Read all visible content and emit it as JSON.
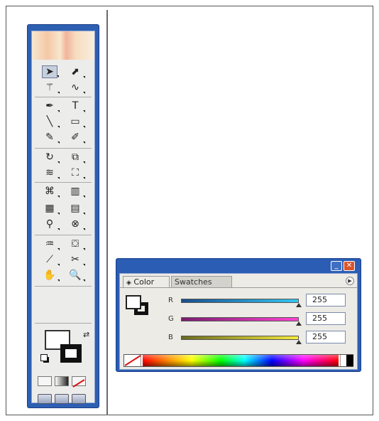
{
  "tools_palette": {
    "tools": [
      {
        "name": "selection-tool-icon",
        "glyph": "➤"
      },
      {
        "name": "direct-selection-tool-icon",
        "glyph": "⬈"
      },
      {
        "name": "magic-wand-tool-icon",
        "glyph": "⚚"
      },
      {
        "name": "lasso-tool-icon",
        "glyph": "∿"
      },
      {
        "name": "pen-tool-icon",
        "glyph": "✒"
      },
      {
        "name": "type-tool-icon",
        "glyph": "T"
      },
      {
        "name": "line-segment-tool-icon",
        "glyph": "╲"
      },
      {
        "name": "rectangle-tool-icon",
        "glyph": "▭"
      },
      {
        "name": "paintbrush-tool-icon",
        "glyph": "✎"
      },
      {
        "name": "pencil-tool-icon",
        "glyph": "✐"
      },
      {
        "name": "rotate-tool-icon",
        "glyph": "↻"
      },
      {
        "name": "scale-tool-icon",
        "glyph": "⧉"
      },
      {
        "name": "warp-tool-icon",
        "glyph": "≋"
      },
      {
        "name": "free-transform-tool-icon",
        "glyph": "⛶"
      },
      {
        "name": "symbol-sprayer-tool-icon",
        "glyph": "⌘"
      },
      {
        "name": "column-graph-tool-icon",
        "glyph": "▥"
      },
      {
        "name": "mesh-tool-icon",
        "glyph": "▦"
      },
      {
        "name": "gradient-tool-icon",
        "glyph": "▤"
      },
      {
        "name": "eyedropper-tool-icon",
        "glyph": "⚲"
      },
      {
        "name": "blend-tool-icon",
        "glyph": "⊗"
      },
      {
        "name": "live-paint-bucket-tool-icon",
        "glyph": "♒"
      },
      {
        "name": "live-paint-selection-tool-icon",
        "glyph": "⛋"
      },
      {
        "name": "slice-tool-icon",
        "glyph": "⟋"
      },
      {
        "name": "scissors-tool-icon",
        "glyph": "✂"
      },
      {
        "name": "hand-tool-icon",
        "glyph": "✋"
      },
      {
        "name": "zoom-tool-icon",
        "glyph": "🔍"
      }
    ],
    "fill_color": "#ffffff",
    "stroke_color": "#000000"
  },
  "color_panel": {
    "tabs": [
      {
        "label": "Color",
        "active": true
      },
      {
        "label": "Swatches",
        "active": false
      }
    ],
    "channels": [
      {
        "label": "R",
        "value": "255",
        "gradient": [
          "#1a4d8c",
          "#33c6f0"
        ]
      },
      {
        "label": "G",
        "value": "255",
        "gradient": [
          "#7a1c6e",
          "#ff44d2"
        ]
      },
      {
        "label": "B",
        "value": "255",
        "gradient": [
          "#6a6a20",
          "#f6ec3a"
        ]
      }
    ],
    "title_buttons": {
      "minimize": "_",
      "close": "✕"
    },
    "accent": "#2b5db4"
  }
}
